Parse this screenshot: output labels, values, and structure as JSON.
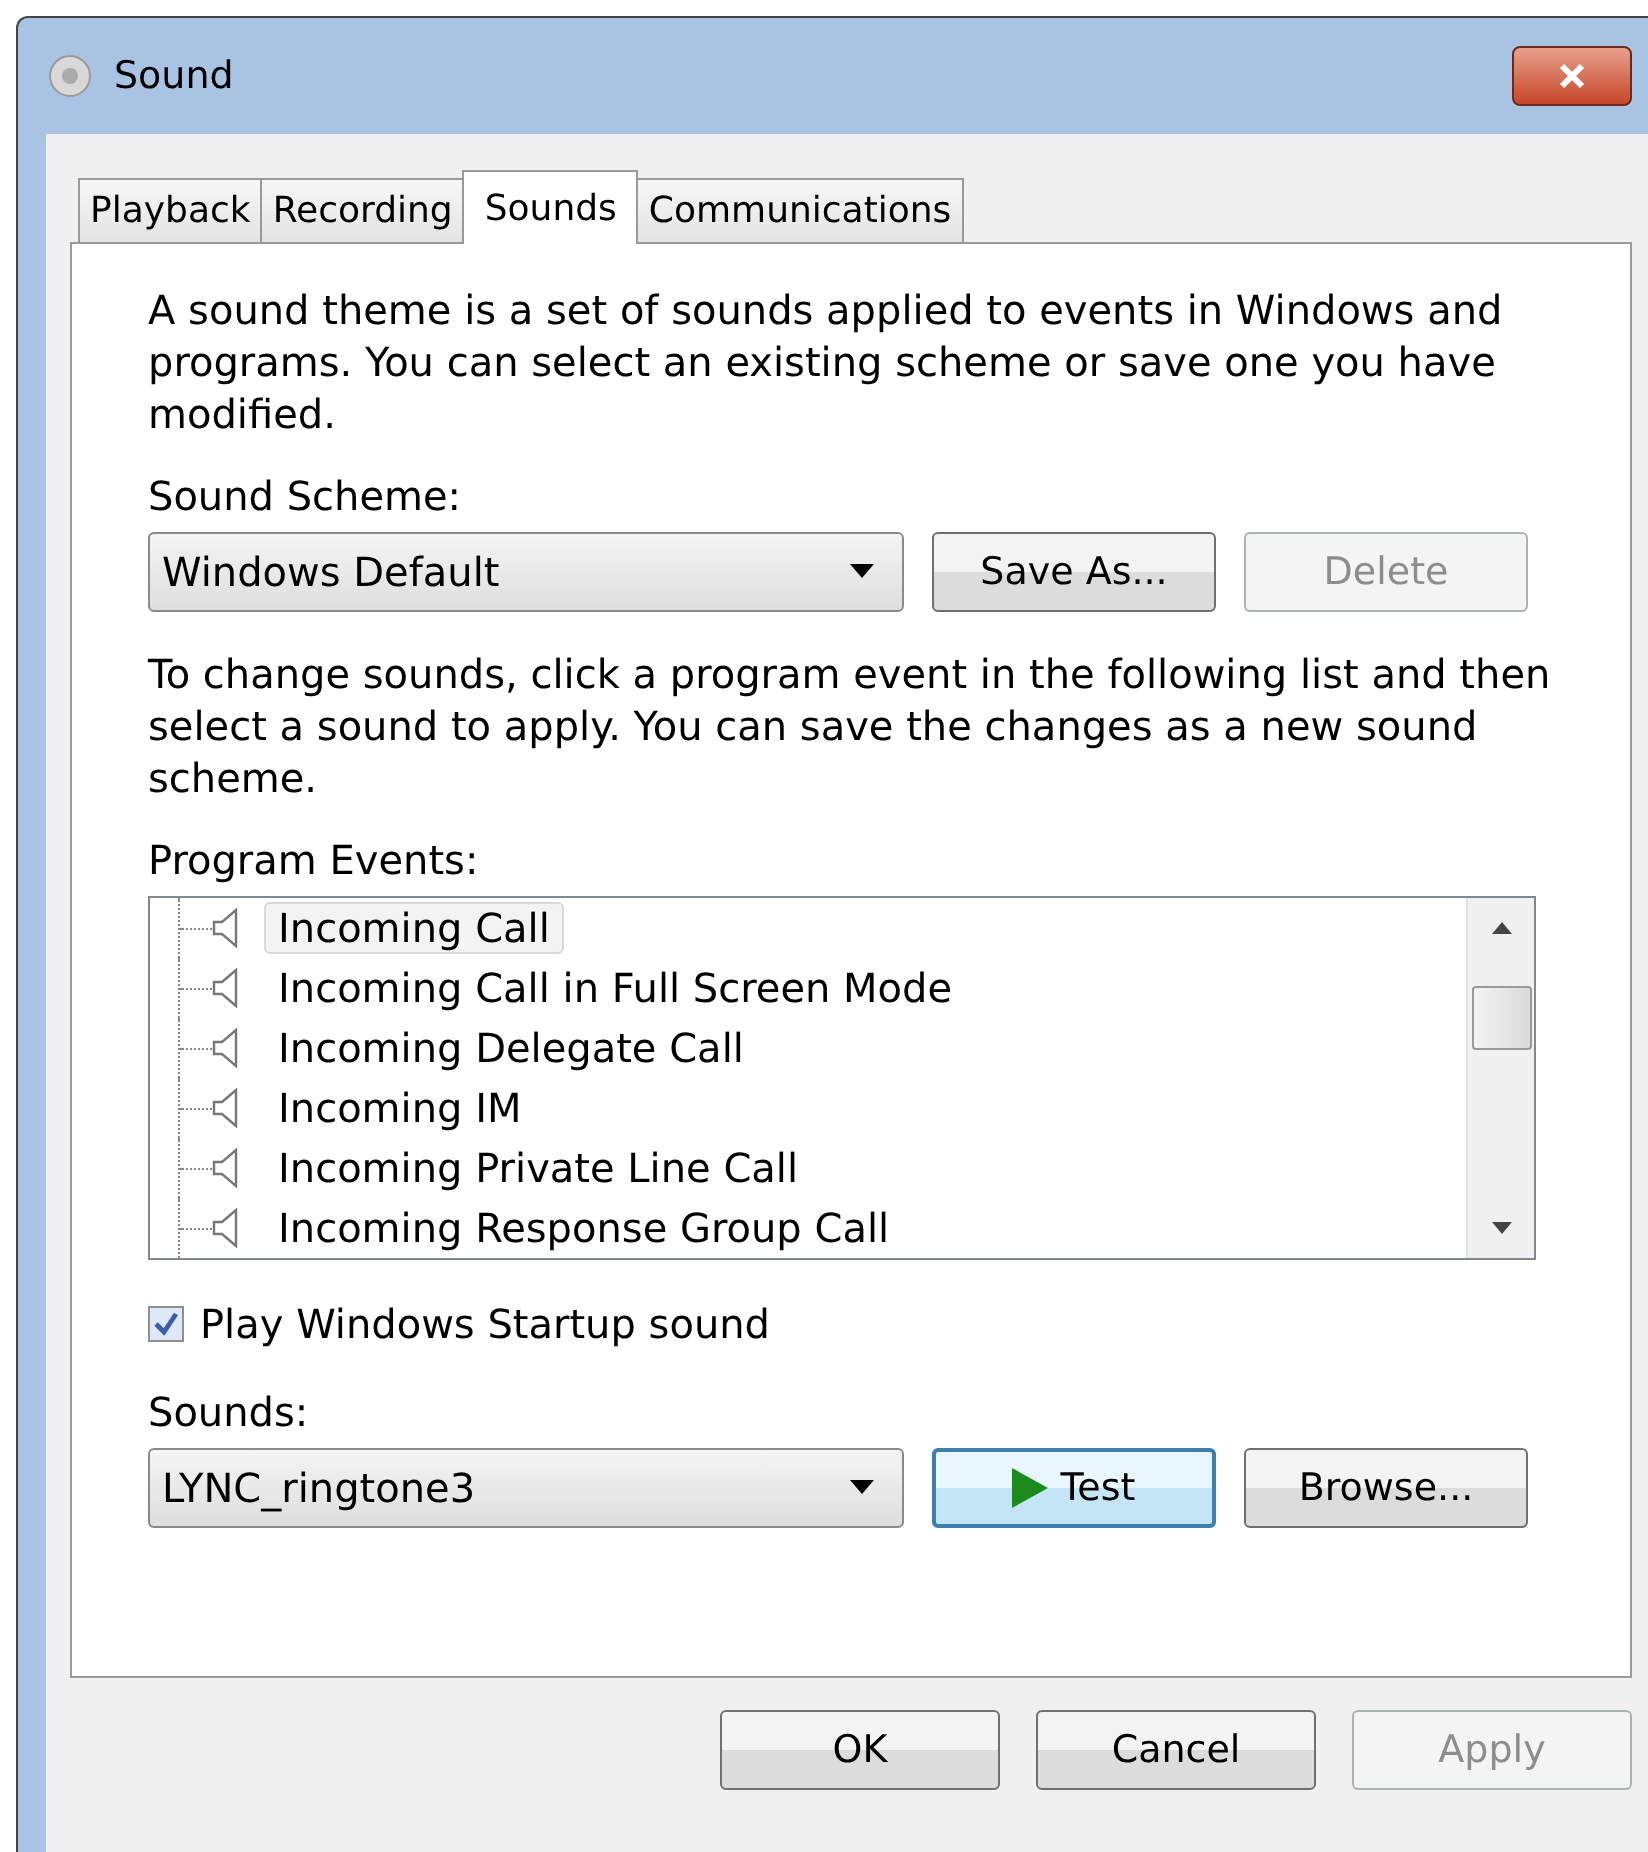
{
  "window": {
    "title": "Sound"
  },
  "tabs": [
    {
      "label": "Playback",
      "selected": false
    },
    {
      "label": "Recording",
      "selected": false
    },
    {
      "label": "Sounds",
      "selected": true
    },
    {
      "label": "Communications",
      "selected": false
    }
  ],
  "intro": "A sound theme is a set of sounds applied to events in Windows and programs.  You can select an existing scheme or save one you have modified.",
  "scheme": {
    "label": "Sound Scheme:",
    "value": "Windows Default",
    "buttons": [
      {
        "label": "Save As...",
        "disabled": false
      },
      {
        "label": "Delete",
        "disabled": true
      }
    ]
  },
  "hint": "To change sounds, click a program event in the following list and then select a sound to apply.  You can save the changes as a new sound scheme.",
  "events": {
    "label": "Program Events:",
    "items": [
      {
        "label": "Incoming Call",
        "selected": true
      },
      {
        "label": "Incoming Call in Full Screen Mode",
        "selected": false
      },
      {
        "label": "Incoming Delegate Call",
        "selected": false
      },
      {
        "label": "Incoming IM",
        "selected": false
      },
      {
        "label": "Incoming Private Line Call",
        "selected": false
      },
      {
        "label": "Incoming Response Group Call",
        "selected": false
      }
    ]
  },
  "startup": {
    "label": "Play Windows Startup sound",
    "checked": true
  },
  "sounds": {
    "label": "Sounds:",
    "value": "LYNC_ringtone3",
    "test": {
      "label": "Test",
      "default": true
    },
    "browse": {
      "label": "Browse...",
      "disabled": false
    }
  },
  "buttons": [
    {
      "label": "OK",
      "disabled": false
    },
    {
      "label": "Cancel",
      "disabled": false
    },
    {
      "label": "Apply",
      "disabled": true
    }
  ]
}
